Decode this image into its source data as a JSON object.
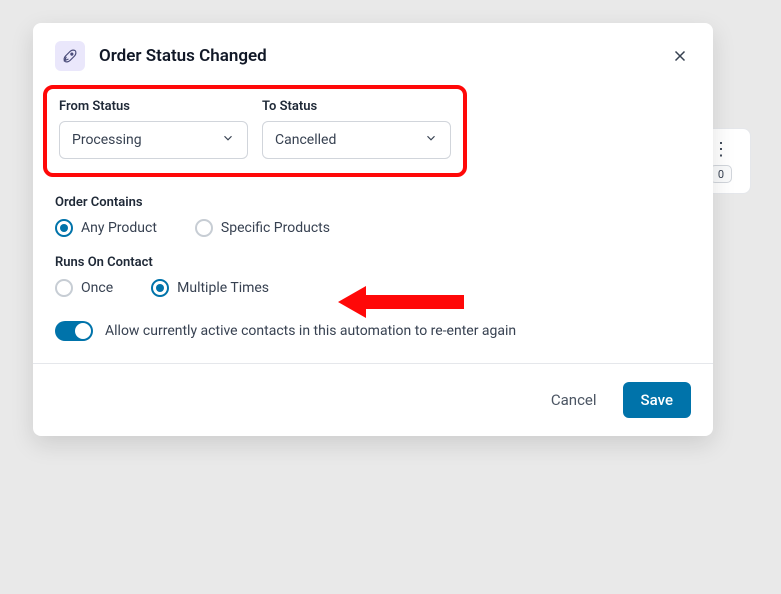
{
  "background": {
    "badge_count": "0"
  },
  "modal": {
    "title": "Order Status Changed",
    "from_status": {
      "label": "From Status",
      "value": "Processing"
    },
    "to_status": {
      "label": "To Status",
      "value": "Cancelled"
    },
    "order_contains": {
      "label": "Order Contains",
      "options": {
        "any": "Any Product",
        "specific": "Specific Products"
      },
      "selected": "any"
    },
    "runs_on_contact": {
      "label": "Runs On Contact",
      "options": {
        "once": "Once",
        "multiple": "Multiple Times"
      },
      "selected": "multiple"
    },
    "reenter_toggle": {
      "enabled": true,
      "label": "Allow currently active contacts in this automation to re-enter again"
    },
    "footer": {
      "cancel": "Cancel",
      "save": "Save"
    }
  },
  "colors": {
    "accent": "#0073aa",
    "highlight": "#ff0808"
  }
}
